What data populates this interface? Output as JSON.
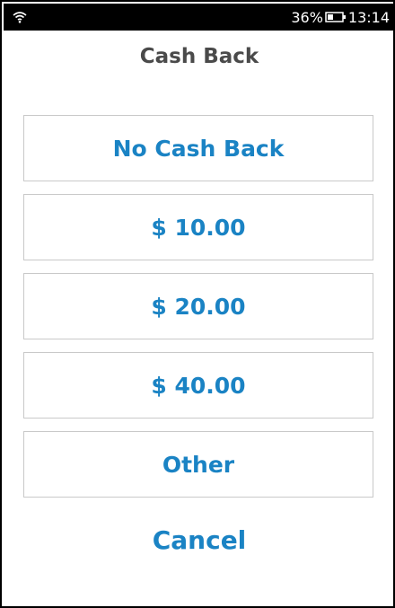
{
  "status_bar": {
    "battery_percent": "36%",
    "time": "13:14",
    "icons": [
      "wifi-icon",
      "battery-icon"
    ]
  },
  "screen": {
    "title": "Cash Back",
    "options": [
      {
        "label": "No Cash Back"
      },
      {
        "label": "$ 10.00"
      },
      {
        "label": "$ 20.00"
      },
      {
        "label": "$ 40.00"
      },
      {
        "label": "Other"
      }
    ],
    "cancel_label": "Cancel"
  },
  "colors": {
    "accent": "#1a83c4",
    "title": "#4a4a4a",
    "border": "#c9c9c9",
    "status_bar": "#000000"
  }
}
